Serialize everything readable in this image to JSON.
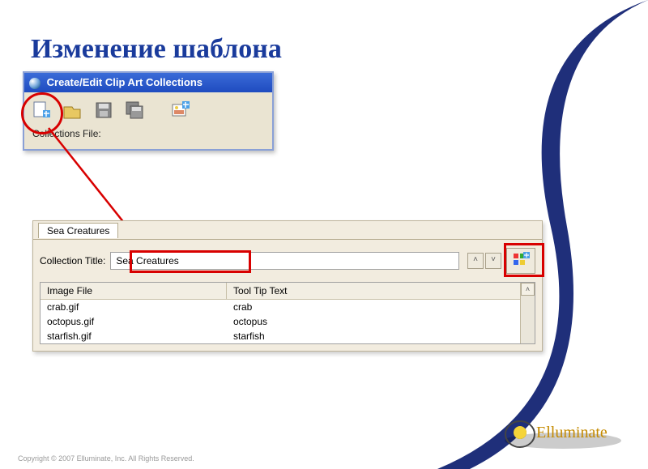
{
  "slide": {
    "title": "Изменение шаблона"
  },
  "topWindow": {
    "title": "Create/Edit Clip Art Collections",
    "collectionsLabel": "Collections File:"
  },
  "bottomPanel": {
    "tab": "Sea Creatures",
    "collectionTitleLabel": "Collection Title:",
    "collectionTitleValue": "Sea Creatures",
    "headers": {
      "imageFile": "Image File",
      "toolTip": "Tool Tip Text"
    },
    "rows": [
      {
        "file": "crab.gif",
        "tip": "crab"
      },
      {
        "file": "octopus.gif",
        "tip": "octopus"
      },
      {
        "file": "starfish.gif",
        "tip": "starfish"
      }
    ]
  },
  "footer": {
    "copyright": "Copyright © 2007 Elluminate, Inc. All Rights Reserved."
  },
  "logo": {
    "text": "Elluminate"
  }
}
